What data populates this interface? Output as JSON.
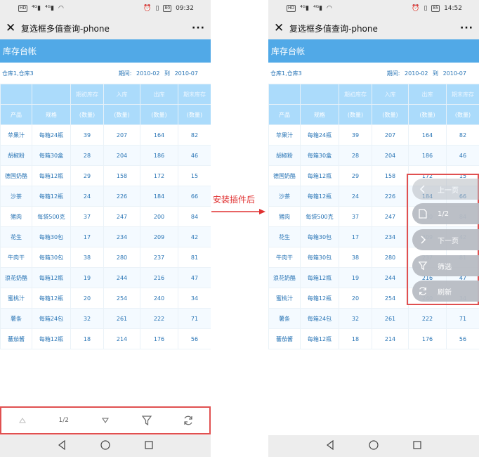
{
  "status_left": {
    "time": "09:32",
    "battery": "80"
  },
  "status_right": {
    "time": "14:52",
    "battery": "85"
  },
  "title": "复选框多值查询-phone",
  "banner": "库存台帐",
  "params": {
    "warehouses": "仓库1,仓库3",
    "period_label": "期间:",
    "from": "2010-02",
    "to_label": "到",
    "to": "2010-07"
  },
  "header_top": [
    "",
    "",
    "期初库存",
    "入库",
    "出库",
    "期末库存"
  ],
  "header_sub": [
    "产品",
    "规格",
    "(数量)",
    "(数量)",
    "(数量)",
    "(数量)"
  ],
  "rows": [
    [
      "苹果汁",
      "每箱24瓶",
      "39",
      "207",
      "164",
      "82"
    ],
    [
      "胡椒粉",
      "每箱30盒",
      "28",
      "204",
      "186",
      "46"
    ],
    [
      "德国奶酪",
      "每箱12瓶",
      "29",
      "158",
      "172",
      "15"
    ],
    [
      "沙茶",
      "每箱12瓶",
      "24",
      "226",
      "184",
      "66"
    ],
    [
      "猪肉",
      "每袋500克",
      "37",
      "247",
      "200",
      "84"
    ],
    [
      "花生",
      "每箱30包",
      "17",
      "234",
      "209",
      "42"
    ],
    [
      "牛肉干",
      "每箱30包",
      "38",
      "280",
      "237",
      "81"
    ],
    [
      "浪花奶酪",
      "每箱12瓶",
      "19",
      "244",
      "216",
      "47"
    ],
    [
      "蜜桃汁",
      "每箱12瓶",
      "20",
      "254",
      "240",
      "34"
    ],
    [
      "薯条",
      "每箱24包",
      "32",
      "261",
      "222",
      "71"
    ],
    [
      "蕃茄酱",
      "每箱12瓶",
      "18",
      "214",
      "176",
      "56"
    ]
  ],
  "bottom_bar": {
    "page": "1/2"
  },
  "annotation": "安装插件后",
  "float_menu": {
    "prev": "上一页",
    "page": "1/2",
    "next": "下一页",
    "filter": "筛选",
    "refresh": "刷新"
  }
}
